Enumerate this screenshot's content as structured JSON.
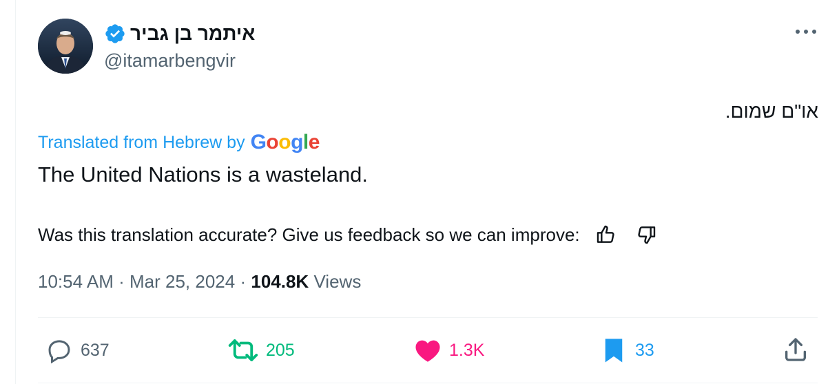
{
  "author": {
    "display_name": "איתמר בן גביר",
    "handle": "@itamarbengvir",
    "verified_icon": "verified-badge-icon"
  },
  "tweet": {
    "original_text": "או\"ם שמום.",
    "translated_label": "Translated from Hebrew by",
    "translator_brand": [
      "G",
      "o",
      "o",
      "g",
      "l",
      "e"
    ],
    "translation": "The United Nations is a wasteland.",
    "feedback_prompt": "Was this translation accurate? Give us feedback so we can improve:",
    "time": "10:54 AM",
    "date": "Mar 25, 2024",
    "views_count": "104.8K",
    "views_label": "Views",
    "separator": "·"
  },
  "actions": {
    "replies": "637",
    "retweets": "205",
    "likes": "1.3K",
    "bookmarks": "33"
  },
  "colors": {
    "accent": "#1d9bf0",
    "retweet": "#00ba7c",
    "like": "#f91880",
    "muted": "#536471"
  }
}
